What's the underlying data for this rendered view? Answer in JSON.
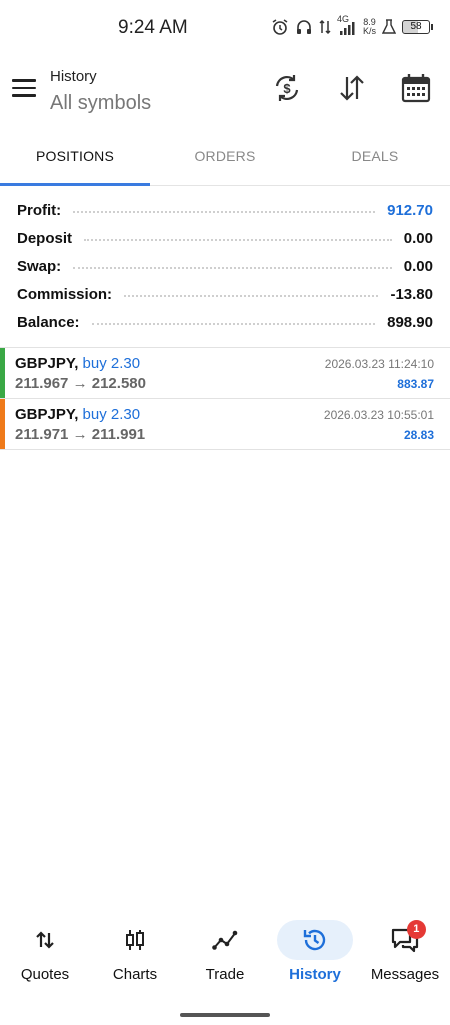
{
  "status_bar": {
    "time": "9:24 AM",
    "network": "4G",
    "speed_value": "8.9",
    "speed_unit": "K/s",
    "battery": "58"
  },
  "header": {
    "title": "History",
    "subtitle": "All symbols"
  },
  "tabs": [
    {
      "label": "POSITIONS",
      "active": true
    },
    {
      "label": "ORDERS",
      "active": false
    },
    {
      "label": "DEALS",
      "active": false
    }
  ],
  "summary": {
    "profit": {
      "label": "Profit:",
      "value": "912.70"
    },
    "deposit": {
      "label": "Deposit",
      "value": "0.00"
    },
    "swap": {
      "label": "Swap:",
      "value": "0.00"
    },
    "commission": {
      "label": "Commission:",
      "value": "-13.80"
    },
    "balance": {
      "label": "Balance:",
      "value": "898.90"
    }
  },
  "deals": [
    {
      "symbol": "GBPJPY,",
      "side": "buy 2.30",
      "open_price": "211.967",
      "arrow": "→",
      "close_price": "212.580",
      "time": "2026.03.23 11:24:10",
      "profit": "883.87",
      "bar_color": "#3aa845"
    },
    {
      "symbol": "GBPJPY,",
      "side": "buy 2.30",
      "open_price": "211.971",
      "arrow": "→",
      "close_price": "211.991",
      "time": "2026.03.23 10:55:01",
      "profit": "28.83",
      "bar_color": "#ef7a1a"
    }
  ],
  "bottom_nav": [
    {
      "label": "Quotes",
      "icon": "quotes-icon"
    },
    {
      "label": "Charts",
      "icon": "charts-icon"
    },
    {
      "label": "Trade",
      "icon": "trade-icon"
    },
    {
      "label": "History",
      "icon": "history-icon",
      "active": true
    },
    {
      "label": "Messages",
      "icon": "messages-icon",
      "badge": "1"
    }
  ],
  "colors": {
    "accent": "#1e6fd9",
    "tab_indicator": "#3a7be0",
    "buy_bar_1": "#3aa845",
    "buy_bar_2": "#ef7a1a",
    "badge": "#e53935"
  }
}
